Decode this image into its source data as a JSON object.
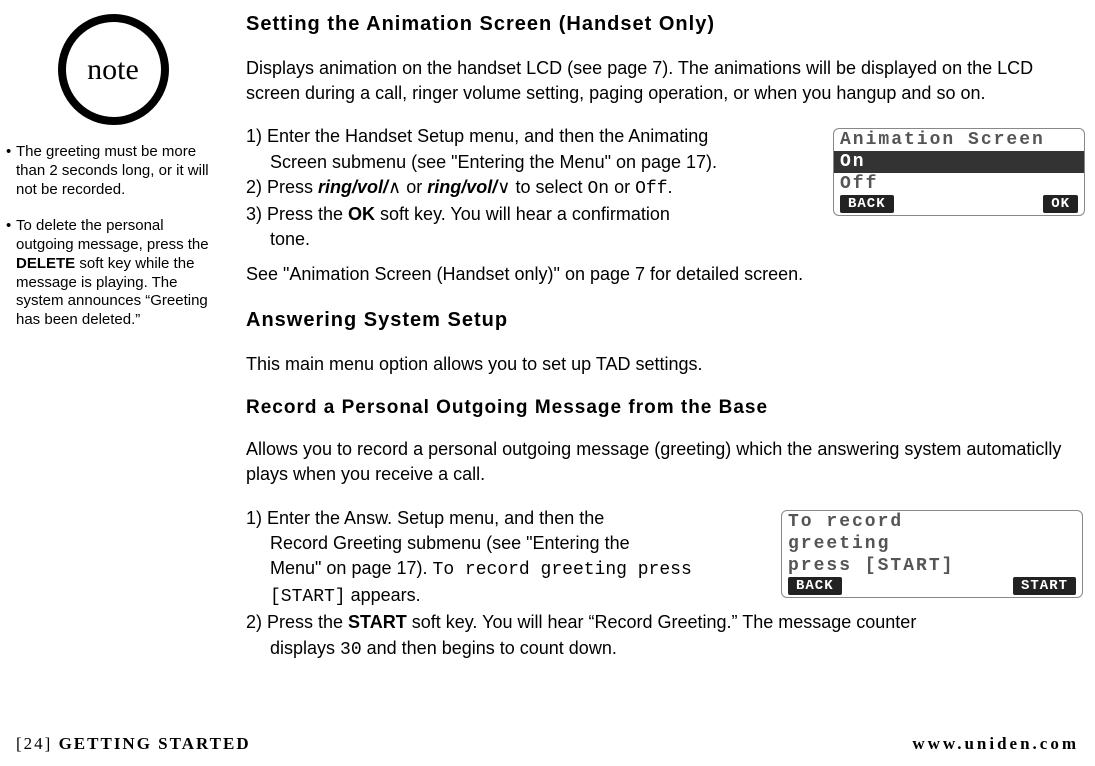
{
  "sidebar": {
    "badge": "note",
    "notes": [
      "The greeting must be more than 2 seconds long, or it will not be recorded.",
      "To delete the personal outgoing message, press the DELETE soft key while the message is playing. The system announces “Greeting has been deleted.”"
    ]
  },
  "s1": {
    "title": "Setting the Animation Screen (Handset Only)",
    "intro": "Displays animation on the handset LCD (see page 7). The animations will be displayed on the LCD screen during a call, ringer volume setting, paging operation, or when you hangup and so on.",
    "step1a": "1) Enter the Handset Setup menu, and then the Animating",
    "step1b": "Screen submenu (see \"Entering the Menu\" on page 17).",
    "step2_pre": "2) Press ",
    "step2_key1": "ring/vol/",
    "step2_sym1": "∧",
    "step2_mid": " or ",
    "step2_key2": "ring/vol/",
    "step2_sym2": "∨",
    "step2_sel": " to select ",
    "step2_on": "On",
    "step2_or": " or ",
    "step2_off": "Off",
    "step2_end": ".",
    "step3_pre": "3) Press the ",
    "step3_key": "OK",
    "step3_mid": " soft key. You will hear a confirmation",
    "step3_cont": "tone.",
    "after": "See \"Animation Screen (Handset only)\" on page 7 for detailed screen.",
    "lcd": {
      "title": "Animation Screen",
      "opt_sel": "On",
      "opt2": "Off",
      "back": "BACK",
      "ok": "OK"
    }
  },
  "s2": {
    "title": "Answering System Setup",
    "intro": "This main menu option allows you to set up TAD settings."
  },
  "s3": {
    "title": "Record a Personal Outgoing Message from the Base",
    "intro": "Allows you to record a personal outgoing message (greeting) which the answering system automaticlly plays when you receive a call.",
    "step1a": "1) Enter the Answ. Setup menu, and then the",
    "step1b": "Record Greeting submenu (see \"Entering the",
    "step1c_pre": "Menu\" on page 17). ",
    "step1c_lcd": "To record greeting press",
    "step1d_lcd": "[START]",
    "step1d_post": " appears.",
    "step2_pre": "2) Press the ",
    "step2_key": "START",
    "step2_mid": " soft key. You will hear “Record Greeting.” The message counter",
    "step2b_pre": "displays ",
    "step2b_num": "30",
    "step2b_post": " and then begins to count down.",
    "lcd": {
      "l1": "To record",
      "l2": "greeting",
      "l3": "press [START]",
      "back": "BACK",
      "start": "START"
    }
  },
  "footer": {
    "page": "[24]",
    "section": " GETTING STARTED",
    "url": "www.uniden.com"
  }
}
